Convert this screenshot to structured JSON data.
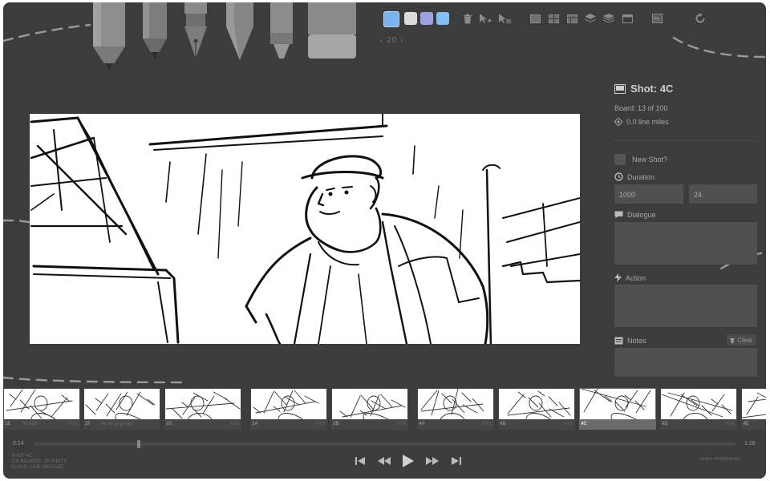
{
  "app": {
    "credit": "studio storyboarder"
  },
  "toolbar": {
    "brush_size": "‹ 20 ›",
    "swatches": [
      "#79b4f2",
      "#dcdcdc",
      "#9aa3e0",
      "#7fc0f0"
    ],
    "buttons": [
      "trash-icon",
      "pointer-add-icon",
      "pointer-layer-icon",
      "layer-1-icon",
      "layer-4-icon",
      "layer-grid-icon",
      "stack-icon",
      "stack-alt-icon",
      "window-icon",
      "image-icon",
      "refresh-icon"
    ]
  },
  "shot": {
    "title": "Shot: 4C",
    "board": "Board: 13 of 100",
    "line_miles": "0.0 line miles",
    "new_shot_label": "New Shot?",
    "duration_label": "Duration",
    "duration_ms": "1000",
    "duration_frames": "24",
    "dialogue_label": "Dialogue",
    "action_label": "Action",
    "notes_label": "Notes",
    "clear_label": "Clear"
  },
  "timeline": {
    "time_start": "0:14",
    "time_end": "1:26",
    "scrub_position": 0.15,
    "thumbnails": [
      {
        "label": "1E",
        "dialogue": "\"SLACK\"",
        "duration": "0:02",
        "active": false
      },
      {
        "label": "2F",
        "dialogue": "fer ler gi go gei",
        "duration": "",
        "active": false
      },
      {
        "label": "2G",
        "dialogue": "",
        "duration": "0:01",
        "active": false
      },
      {
        "label": "3A",
        "dialogue": "",
        "duration": "0:01",
        "active": false
      },
      {
        "label": "3B",
        "dialogue": "",
        "duration": "0:01",
        "active": false
      },
      {
        "label": "4A",
        "dialogue": "",
        "duration": "0:01",
        "active": false
      },
      {
        "label": "4B",
        "dialogue": "",
        "duration": "0:01",
        "active": false
      },
      {
        "label": "4C",
        "dialogue": "",
        "duration": "0:01",
        "active": true
      },
      {
        "label": "4D",
        "dialogue": "",
        "duration": "0:01",
        "active": false
      },
      {
        "label": "4E",
        "dialogue": "",
        "duration": "",
        "active": false
      }
    ]
  },
  "status": {
    "line1": "SHOT 4C",
    "line2": "100 BOARDS, 29 SHOTS",
    "line3": "51 AVG. LINE MILEAGE"
  },
  "transport": [
    "skip-back-icon",
    "rewind-icon",
    "play-icon",
    "fast-forward-icon",
    "skip-forward-icon"
  ]
}
